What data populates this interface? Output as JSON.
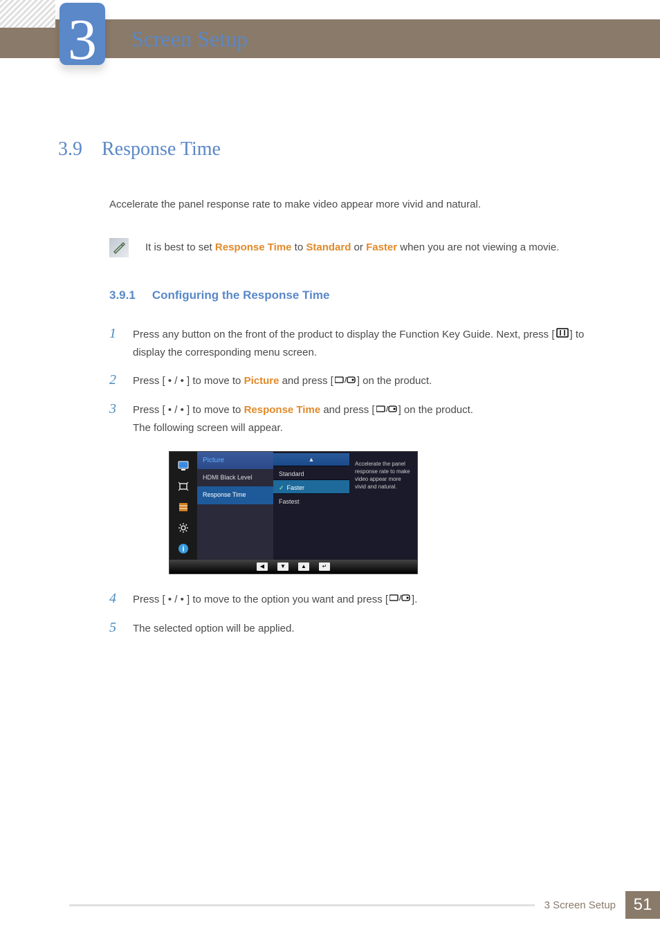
{
  "chapter": {
    "number": "3",
    "title": "Screen Setup"
  },
  "section": {
    "number": "3.9",
    "title": "Response Time"
  },
  "intro": "Accelerate the panel response rate to make video appear more vivid and natural.",
  "note": {
    "pre": "It is best to set ",
    "hl1": "Response Time",
    "mid1": " to ",
    "hl2": "Standard",
    "mid2": " or ",
    "hl3": "Faster",
    "post": " when you are not viewing a movie."
  },
  "subsection": {
    "number": "3.9.1",
    "title": "Configuring the Response Time"
  },
  "steps": {
    "s1": {
      "num": "1",
      "a": "Press any button on the front of the product to display the Function Key Guide. Next, press [",
      "b": "] to display the corresponding menu screen."
    },
    "s2": {
      "num": "2",
      "a": "Press [ • / • ] to move to ",
      "hl": "Picture",
      "b": " and press [",
      "c": "] on the product."
    },
    "s3": {
      "num": "3",
      "a": "Press [ • / • ] to move to ",
      "hl": "Response Time",
      "b": " and press [",
      "c": "] on the product.",
      "sub": "The following screen will appear."
    },
    "s4": {
      "num": "4",
      "a": "Press [ • / • ] to move to the option you want and press [",
      "b": "]."
    },
    "s5": {
      "num": "5",
      "a": "The selected option will be applied."
    }
  },
  "osd": {
    "menu_title": "Picture",
    "items": {
      "i0": "HDMI Black Level",
      "i1": "Response Time"
    },
    "options": {
      "o0": "Standard",
      "o1": "Faster",
      "o2": "Fastest"
    },
    "arrow": "▲",
    "help": "Accelerate the panel response rate to make video appear more vivid and natural.",
    "nav": {
      "left": "◀",
      "down": "▼",
      "up": "▲",
      "enter": "↵"
    }
  },
  "footer": {
    "label": "3 Screen Setup",
    "page": "51"
  }
}
